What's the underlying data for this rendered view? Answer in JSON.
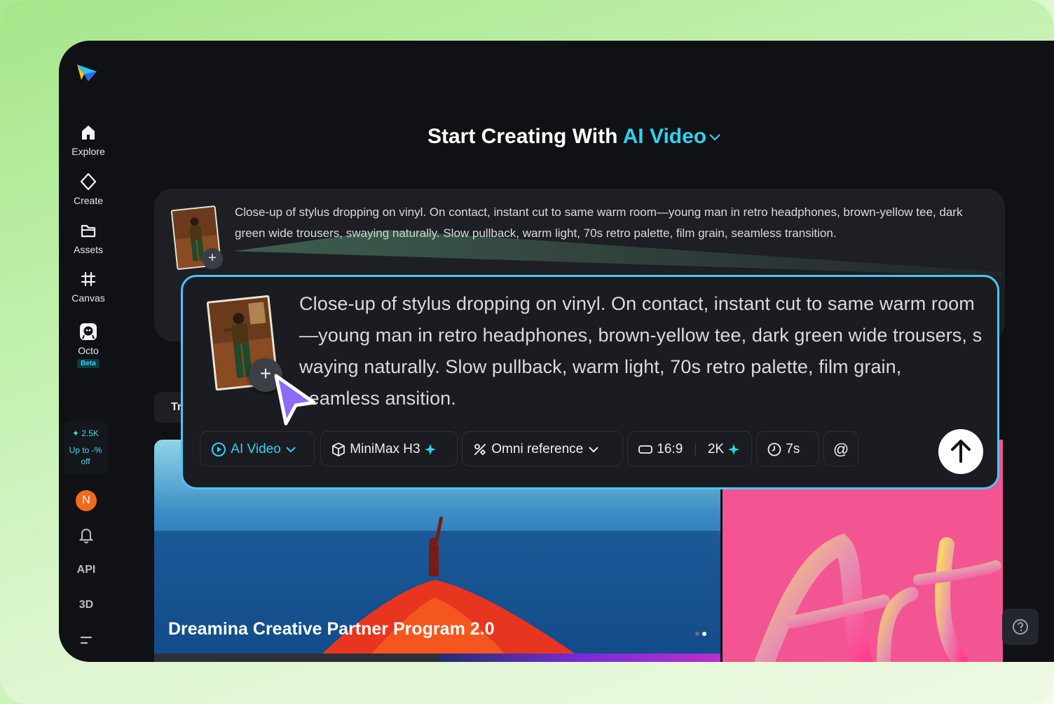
{
  "sidebar": {
    "items": [
      {
        "label": "Explore",
        "icon": "home-icon"
      },
      {
        "label": "Create",
        "icon": "sparkle-diamond-icon"
      },
      {
        "label": "Assets",
        "icon": "folder-icon"
      },
      {
        "label": "Canvas",
        "icon": "grid-frame-icon"
      },
      {
        "label": "Octo",
        "icon": "octo-icon",
        "badge": "Beta"
      }
    ],
    "credits": {
      "amount": "2.5K",
      "promo_line1": "Up to -%",
      "promo_line2": "off"
    },
    "avatar_initial": "N",
    "api_label": "API",
    "threed_label": "3D"
  },
  "heading": {
    "prefix": "Start Creating With",
    "mode": "AI Video"
  },
  "prompt": {
    "text": "Close-up of stylus dropping on vinyl. On contact, instant cut to same warm room—young man in retro headphones, brown-yellow tee, dark green wide trousers, swaying naturally. Slow pullback, warm light, 70s retro palette, film grain, seamless transition.",
    "zoom_text": "Close-up of stylus dropping on vinyl. On contact, instant cut to same warm room —young man in retro headphones, brown-yellow tee, dark green wide trousers, s waying naturally. Slow pullback, warm light, 70s retro palette, film grain, seamless ansition.",
    "add_symbol": "+"
  },
  "toolbar": {
    "mode": "AI Video",
    "model": "MiniMax H3",
    "reference": "Omni reference",
    "ratio": "16:9",
    "resolution": "2K",
    "duration": "7s",
    "mention": "@"
  },
  "tab_partial": "Tr",
  "banner": {
    "title": "Dreamina Creative Partner Program 2.0"
  },
  "colors": {
    "accent": "#2fd2f0",
    "background": "#101114",
    "highlight_border": "#4cc6ee",
    "avatar": "#f26a1b"
  }
}
